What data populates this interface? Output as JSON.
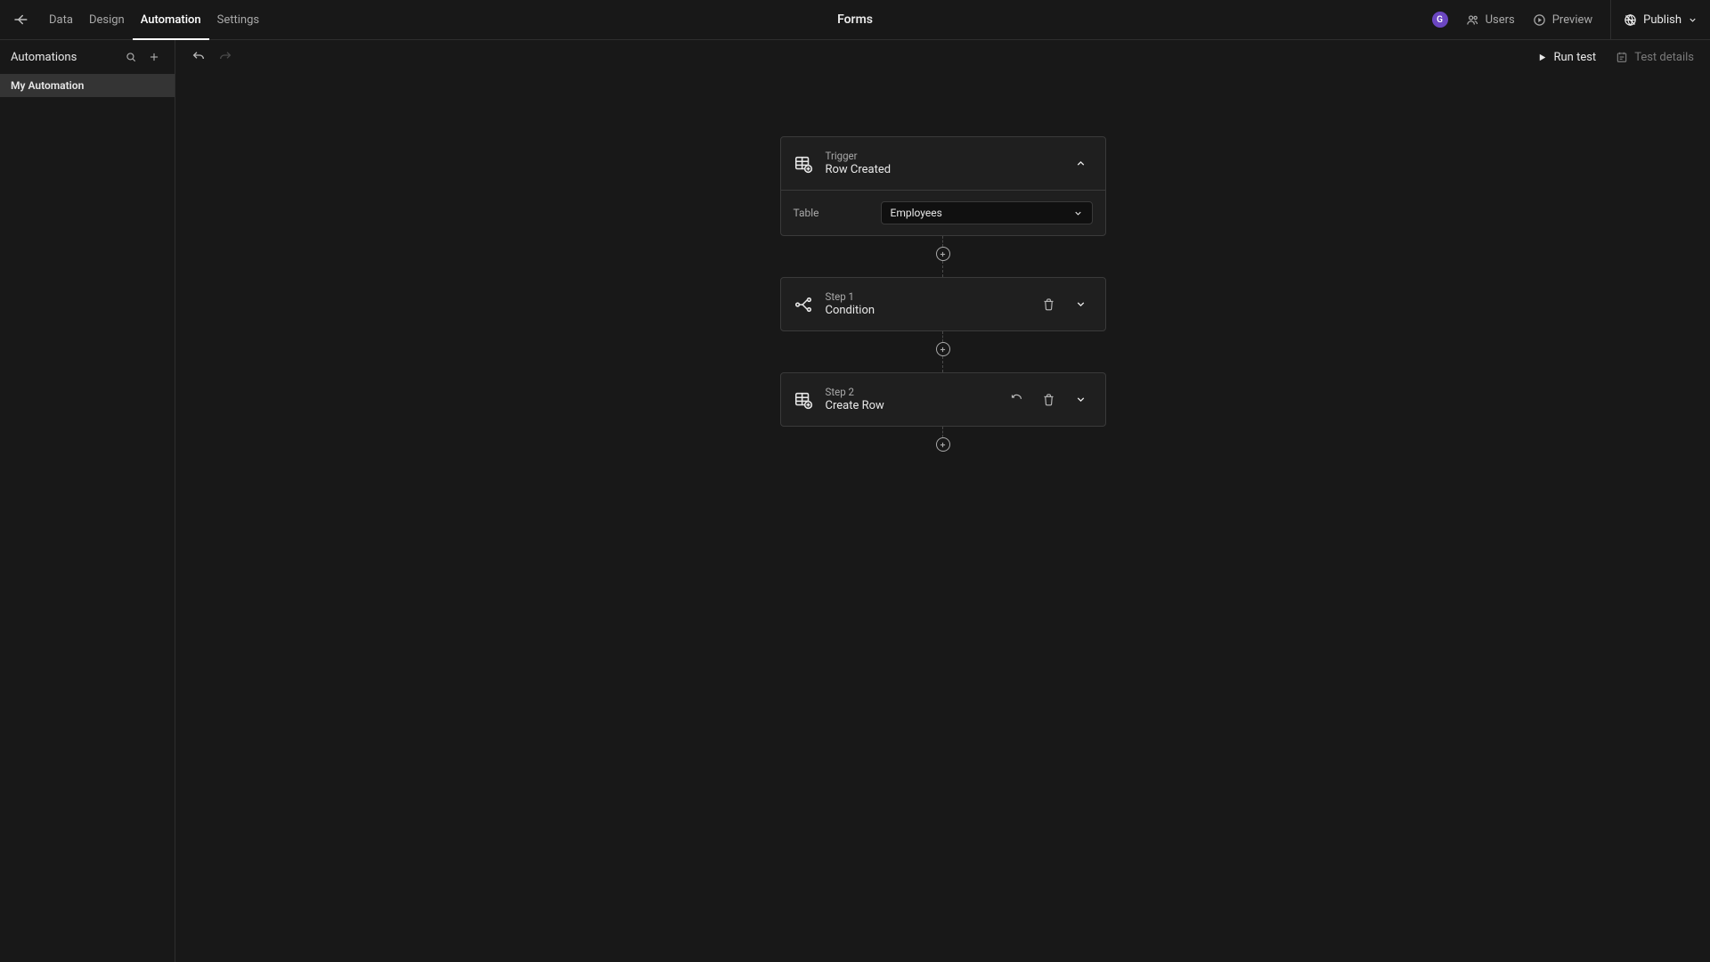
{
  "header": {
    "app_title": "Forms",
    "tabs": {
      "data": "Data",
      "design": "Design",
      "automation": "Automation",
      "settings": "Settings"
    },
    "avatar_initial": "G",
    "users_label": "Users",
    "preview_label": "Preview",
    "publish_label": "Publish"
  },
  "sidebar": {
    "title": "Automations",
    "items": [
      {
        "label": "My Automation",
        "active": true
      }
    ]
  },
  "toolbar": {
    "run_test_label": "Run test",
    "test_details_label": "Test details"
  },
  "flow": {
    "trigger": {
      "label": "Trigger",
      "title": "Row Created",
      "field_label": "Table",
      "field_value": "Employees"
    },
    "step1": {
      "label": "Step 1",
      "title": "Condition"
    },
    "step2": {
      "label": "Step 2",
      "title": "Create Row"
    }
  }
}
